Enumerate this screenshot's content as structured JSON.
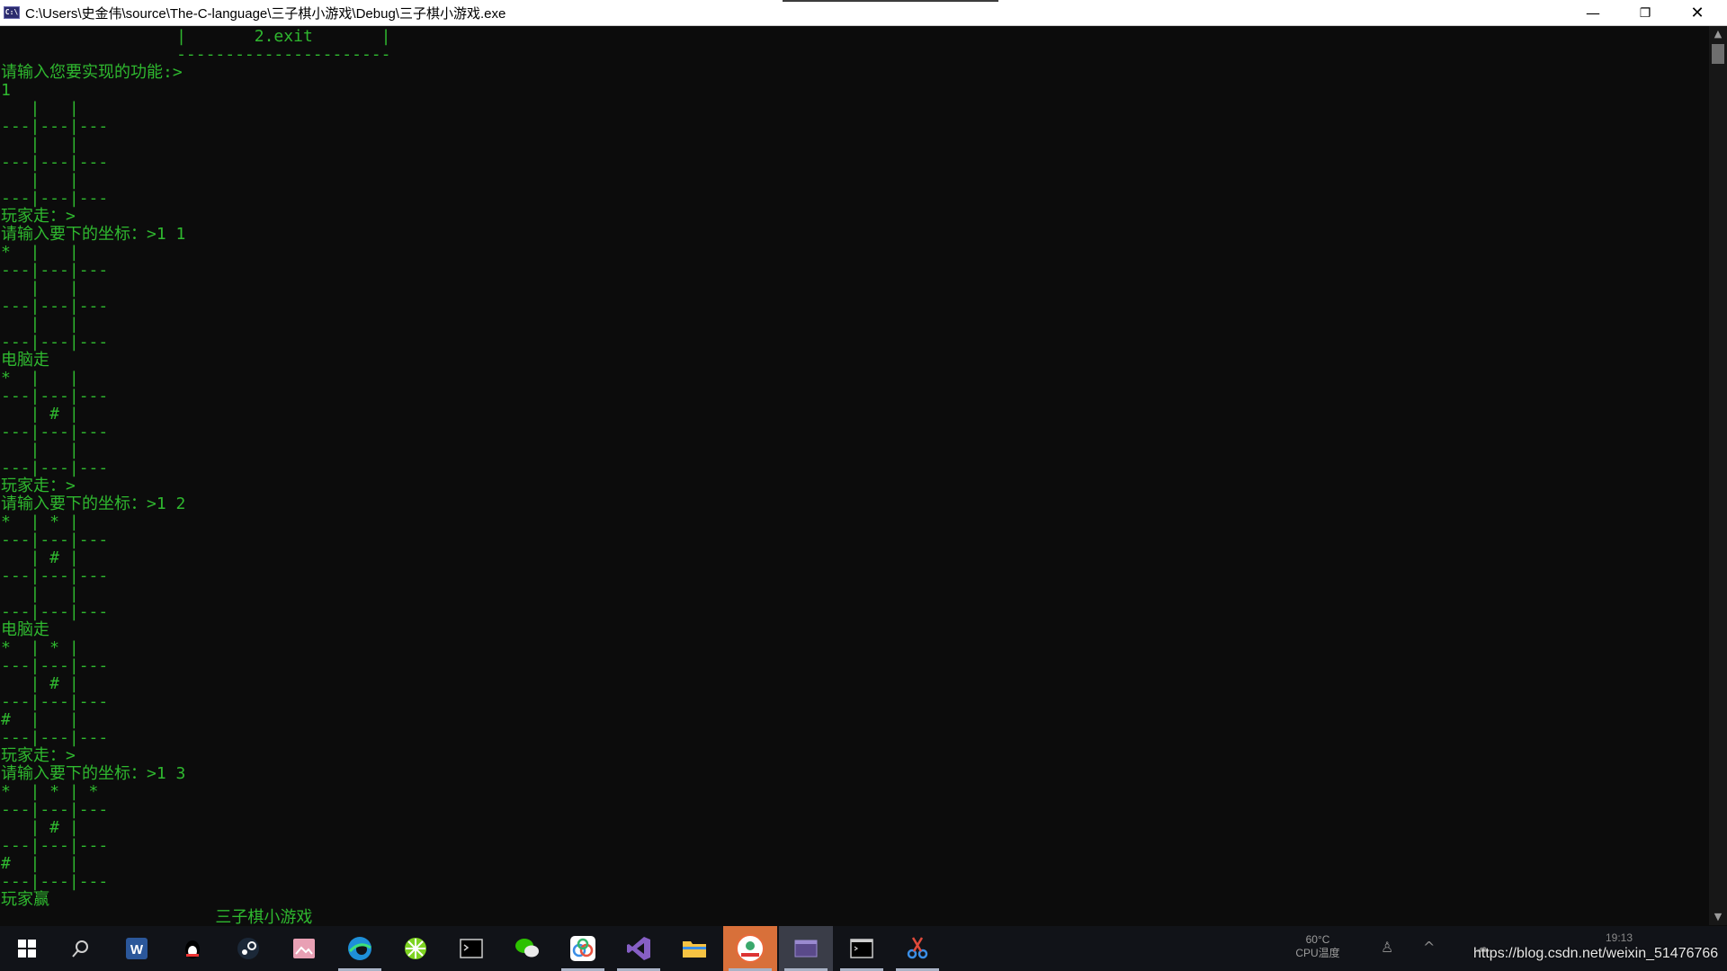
{
  "window": {
    "title": "C:\\Users\\史金伟\\source\\The-C-language\\三子棋小游戏\\Debug\\三子棋小游戏.exe",
    "app_icon_text": "C:\\",
    "minimize_glyph": "—",
    "maximize_glyph": "❐",
    "close_glyph": "✕"
  },
  "console": {
    "text_color": "#2fb82f",
    "background": "#0c0c0c",
    "lines": [
      "                  |       2.exit       |",
      "                  ----------------------",
      "请输入您要实现的功能:>",
      "1",
      "   |   |",
      "---|---|---",
      "   |   |",
      "---|---|---",
      "   |   |",
      "---|---|---",
      "玩家走：>",
      "请输入要下的坐标：>1 1",
      "*  |   |",
      "---|---|---",
      "   |   |",
      "---|---|---",
      "   |   |",
      "---|---|---",
      "电脑走",
      "*  |   |",
      "---|---|---",
      "   | # |",
      "---|---|---",
      "   |   |",
      "---|---|---",
      "玩家走：>",
      "请输入要下的坐标：>1 2",
      "*  | * |",
      "---|---|---",
      "   | # |",
      "---|---|---",
      "   |   |",
      "---|---|---",
      "电脑走",
      "*  | * |",
      "---|---|---",
      "   | # |",
      "---|---|---",
      "#  |   |",
      "---|---|---",
      "玩家走：>",
      "请输入要下的坐标：>1 3",
      "*  | * | *",
      "---|---|---",
      "   | # |",
      "---|---|---",
      "#  |   |",
      "---|---|---",
      "玩家赢",
      "                      三子棋小游戏"
    ]
  },
  "scrollbar": {
    "up_glyph": "▲",
    "down_glyph": "▼"
  },
  "taskbar": {
    "items": [
      {
        "name": "start-windows-icon",
        "color": "#ffffff"
      },
      {
        "name": "search-icon",
        "color": "#cfcfcf"
      },
      {
        "name": "word-icon",
        "color": "#2b579a"
      },
      {
        "name": "qq-penguin-icon",
        "color": "#000000"
      },
      {
        "name": "steam-icon",
        "color": "#1b2838"
      },
      {
        "name": "photo-app-icon",
        "color": "#e8a0b4"
      },
      {
        "name": "edge-browser-icon",
        "color": "#1e8fd8"
      },
      {
        "name": "lime-app-icon",
        "color": "#7ed321"
      },
      {
        "name": "terminal-icon",
        "color": "#cccccc"
      },
      {
        "name": "wechat-icon",
        "color": "#2dc100"
      },
      {
        "name": "baidu-netdisk-icon",
        "color": "#3a8ee6"
      },
      {
        "name": "visual-studio-icon",
        "color": "#865fc5"
      },
      {
        "name": "file-explorer-icon",
        "color": "#f6c343"
      },
      {
        "name": "app-badge-icon",
        "color": "#e86a3b"
      },
      {
        "name": "console-app-icon",
        "color": "#5a4a8a"
      },
      {
        "name": "cmd-icon",
        "color": "#cccccc"
      },
      {
        "name": "snipping-tool-icon",
        "color": "#e04a3b"
      }
    ],
    "tray": {
      "temp_value": "60°C",
      "temp_label": "CPU温度",
      "person_glyph": "♙",
      "chevron_glyph": "^",
      "cloud_glyph": "☁",
      "time": "19:13"
    }
  },
  "watermark": "https://blog.csdn.net/weixin_51476766"
}
